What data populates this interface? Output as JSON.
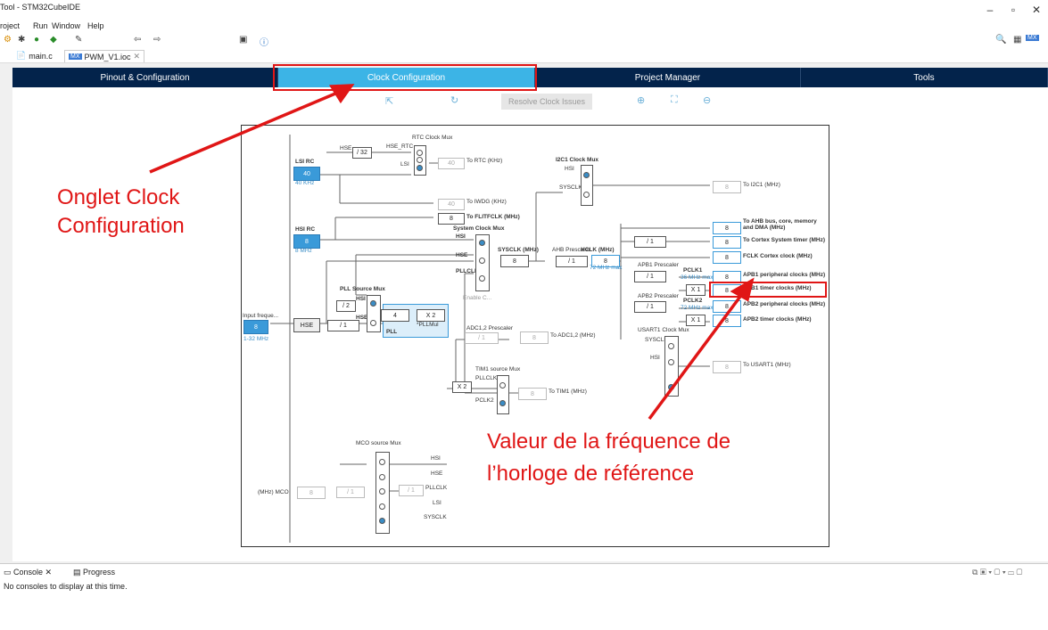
{
  "window": {
    "title": "Tool - STM32CubeIDE"
  },
  "menu": [
    "roject",
    "Run",
    "Window",
    "Help"
  ],
  "file_tabs": [
    {
      "label": "main.c"
    },
    {
      "label": "PWM_V1.ioc",
      "badge": "MX"
    }
  ],
  "nav_tabs": [
    "Pinout & Configuration",
    "Clock Configuration",
    "Project Manager",
    "Tools"
  ],
  "toolbar2": {
    "resolve": "Resolve Clock Issues"
  },
  "diagram": {
    "rtc_mux": "RTC Clock Mux",
    "hse": "HSE",
    "div32": "/ 32",
    "hse_rtc": "HSE_RTC",
    "lsi": "LSI",
    "lsi_rc": "LSI RC",
    "lsi_val": "40",
    "lsi_freq": "40 KHz",
    "to_rtc": "To RTC (KHz)",
    "rtc_val": "40",
    "iwdg_val": "40",
    "to_iwdg": "To IWDG (KHz)",
    "flit_val": "8",
    "to_flit": "To FLITFCLK (MHz)",
    "hsi_rc": "HSI RC",
    "hsi_val": "8",
    "hsi_freq": "8 MHz",
    "sys_mux": "System Clock Mux",
    "hsi": "HSI",
    "pllclk": "PLLCLK",
    "sysclk": "SYSCLK (MHz)",
    "sysclk_val": "8",
    "ahb": "AHB Prescaler",
    "ahb_div": "/ 1",
    "hclk": "HCLK (MHz)",
    "hclk_val": "8",
    "hclk_max": "72 MHz max",
    "enable_css": "Enable C...",
    "pll_src": "PLL Source Mux",
    "div2": "/ 2",
    "pll": "PLL",
    "pll_val": "4",
    "pllmul": "X 2",
    "pllmul_lbl": "*PLLMul",
    "input_freq": "Input freque...",
    "input_val": "8",
    "input_range": "1-32 MHz",
    "hse_box": "HSE",
    "hse_div": "/ 1",
    "i2c_mux": "I2C1 Clock Mux",
    "sysclk_lbl": "SYSCLK",
    "i2c_val": "8",
    "to_i2c": "To I2C1 (MHz)",
    "ahb_bus": "To AHB bus, core, memory and DMA (MHz)",
    "cortex_div": "/ 1",
    "to_cortex": "To Cortex System timer (MHz)",
    "fclk": "FCLK Cortex clock (MHz)",
    "apb1_pre": "APB1 Prescaler",
    "apb1_div": "/ 1",
    "pclk1": "PCLK1",
    "pclk1_max": "36 MHz max",
    "apb1_periph": "APB1 peripheral clocks (MHz)",
    "x1": "X 1",
    "apb1_timer": "APB1 timer clocks (MHz)",
    "apb2_pre": "APB2 Prescaler",
    "apb2_div": "/ 1",
    "pclk2": "PCLK2",
    "pclk2_max": "72 MHz max",
    "apb2_periph": "APB2 peripheral clocks (MHz)",
    "apb2_timer": "APB2 timer clocks (MHz)",
    "adc_pre": "ADC1,2 Prescaler",
    "adc_div": "/ 1",
    "adc_val": "8",
    "to_adc": "To ADC1,2 (MHz)",
    "usart_mux": "USART1 Clock Mux",
    "usart_val": "8",
    "to_usart": "To USART1 (MHz)",
    "tim1_mux": "TIM1 source Mux",
    "x2": "X 2",
    "pllclkx": "PLLCLKx",
    "pclk2x": "PCLK2",
    "tim1_val": "8",
    "to_tim1": "To TIM1 (MHz)",
    "mco_mux": "MCO source Mux",
    "mco": "(MHz) MCO",
    "mco_val": "8",
    "mco_div": "/ 1",
    "mco_div2": "/ 1",
    "mco_hsi": "HSI",
    "mco_hse": "HSE",
    "mco_pll": "PLLCLK",
    "mco_lsi": "LSI",
    "mco_sys": "SYSCLK",
    "v8": "8"
  },
  "annotations": {
    "tab": "Onglet Clock Configuration",
    "line1": "Onglet Clock",
    "line2": "Configuration",
    "freq1": "Valeur de la fréquence de",
    "freq2": "l’horloge de référence"
  },
  "console": {
    "tab1": "Console",
    "tab2": "Progress",
    "text": "No consoles to display at this time."
  }
}
